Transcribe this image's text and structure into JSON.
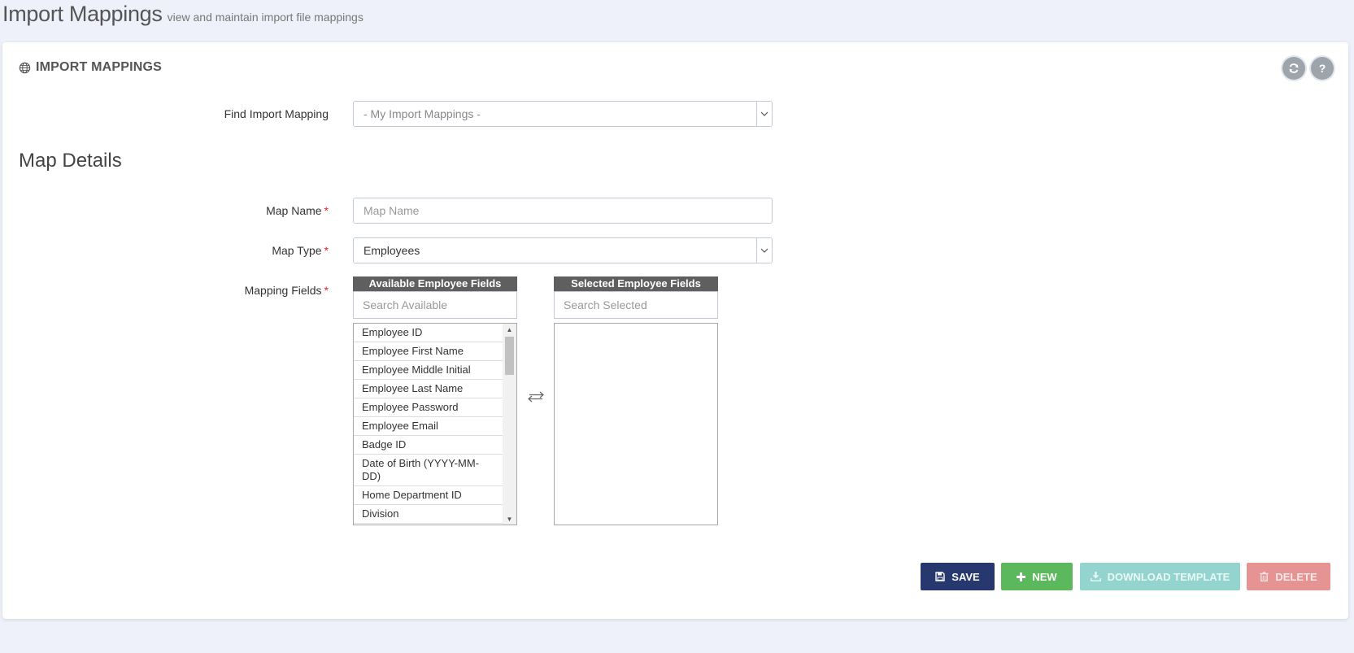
{
  "page": {
    "title": "Import Mappings",
    "subtitle": "view and maintain import file mappings"
  },
  "portlet": {
    "caption": "IMPORT MAPPINGS",
    "icon": "globe-icon",
    "tools": [
      {
        "icon": "refresh-icon"
      },
      {
        "icon": "help-icon",
        "glyph": "?"
      }
    ]
  },
  "find": {
    "label": "Find Import Mapping",
    "value": "- My Import Mappings -"
  },
  "section_title": "Map Details",
  "map_name": {
    "label": "Map Name",
    "required": "*",
    "placeholder": "Map Name",
    "value": ""
  },
  "map_type": {
    "label": "Map Type",
    "required": "*",
    "value": "Employees"
  },
  "mapping_fields": {
    "label": "Mapping Fields",
    "required": "*",
    "available": {
      "header": "Available Employee Fields",
      "search_placeholder": "Search Available",
      "items": [
        "Employee ID",
        "Employee First Name",
        "Employee Middle Initial",
        "Employee Last Name",
        "Employee Password",
        "Employee Email",
        "Badge ID",
        "Date of Birth (YYYY-MM-DD)",
        "Home Department ID",
        "Division"
      ]
    },
    "selected": {
      "header": "Selected Employee Fields",
      "search_placeholder": "Search Selected",
      "items": []
    },
    "swap_icon": "swap-arrows-icon"
  },
  "actions": {
    "save": "SAVE",
    "new": "NEW",
    "download": "DOWNLOAD TEMPLATE",
    "delete": "DELETE"
  },
  "colors": {
    "page_bg": "#eef1f9",
    "save": "#26386e",
    "new": "#5cb85c",
    "download": "#94d4cf",
    "delete": "#e69394",
    "required": "#e02222"
  }
}
